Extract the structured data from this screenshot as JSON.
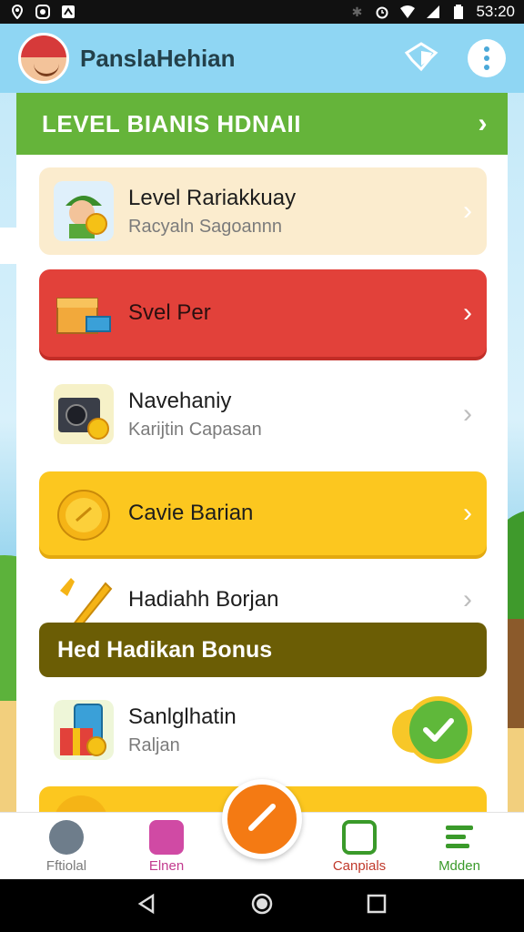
{
  "status_bar": {
    "time": "53:20",
    "icons_left": [
      "location-icon",
      "whatsapp-icon",
      "notification-icon"
    ],
    "icons_right": [
      "bluetooth-icon",
      "alarm-icon",
      "wifi-icon",
      "signal-icon",
      "battery-icon"
    ]
  },
  "app_bar": {
    "title": "PanslaHehian"
  },
  "level_header": {
    "label": "LEVEL BIANIS HDNAII"
  },
  "cards": [
    {
      "title": "Level Rariakkuay",
      "subtitle": "Racyaln Sagoannn",
      "icon": "character-coin-icon"
    },
    {
      "title": "Svel Per",
      "subtitle": "",
      "icon": "treasure-box-icon"
    },
    {
      "title": "Navehaniy",
      "subtitle": "Karijtin Capasan",
      "icon": "camera-coin-icon"
    },
    {
      "title": "Cavie Barian",
      "subtitle": "",
      "icon": "gold-coin-icon"
    },
    {
      "title": "Hadiahh Borjan",
      "subtitle": "",
      "icon": "trophy-icon"
    },
    {
      "title": "Sanlglhatin",
      "subtitle": "Raljan",
      "icon": "gift-phone-icon"
    }
  ],
  "banner": {
    "label": "Hed Hadikan Bonus"
  },
  "toggle": {
    "checked": true
  },
  "bottom_nav": [
    {
      "label": "Fftiolal",
      "color": "#7a7a7a"
    },
    {
      "label": "Elnen",
      "color": "#c23a8e"
    },
    {
      "label": "Canpials",
      "color": "#c0392b"
    },
    {
      "label": "Mdden",
      "color": "#3a9a2a"
    }
  ],
  "colors": {
    "accent_green": "#65b43a",
    "card_red": "#e2413a",
    "card_yellow": "#fcc71f",
    "banner_olive": "#6b5d05",
    "fab_orange": "#f47a13"
  }
}
